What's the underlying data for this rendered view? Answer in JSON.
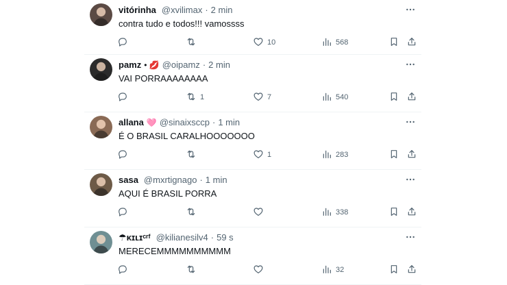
{
  "tweets": [
    {
      "name": "vitórinha",
      "badge": "",
      "handle": "@xvilimax",
      "time": "2 min",
      "text": "contra tudo e todos!!!  vamossss",
      "replies": "",
      "retweets": "",
      "likes": "10",
      "views": "568",
      "avatar_color": "#5b4a44"
    },
    {
      "name": "pamz",
      "badge": "• 💋",
      "handle": "@oipamz",
      "time": "2 min",
      "text": "VAI PORRAAAAAAAA",
      "replies": "",
      "retweets": "1",
      "likes": "7",
      "views": "540",
      "avatar_color": "#2b2b2b"
    },
    {
      "name": "allana",
      "badge": "🩷",
      "handle": "@sinaixsccp",
      "time": "1 min",
      "text": "É O BRASIL CARALHOOOOOOO",
      "replies": "",
      "retweets": "",
      "likes": "1",
      "views": "283",
      "avatar_color": "#8a6a55"
    },
    {
      "name": "sasa",
      "badge": "",
      "handle": "@mxrtignago",
      "time": "1 min",
      "text": "AQUI É BRASIL PORRA",
      "replies": "",
      "retweets": "",
      "likes": "",
      "views": "338",
      "avatar_color": "#6d5a47"
    },
    {
      "name": "☂ᴋɪʟɪᶜʳᶠ",
      "badge": "",
      "handle": "@kilianesilv4",
      "time": "59 s",
      "text": "MERECEMMMMMMMMMM",
      "replies": "",
      "retweets": "",
      "likes": "",
      "views": "32",
      "avatar_color": "#6f8f93"
    }
  ],
  "icons": {
    "more": "more-icon",
    "reply": "reply-icon",
    "retweet": "retweet-icon",
    "like": "heart-icon",
    "views": "views-icon",
    "bookmark": "bookmark-icon",
    "share": "share-icon"
  },
  "colors": {
    "text": "#0f1419",
    "secondary": "#536471",
    "divider": "#eff3f4"
  }
}
